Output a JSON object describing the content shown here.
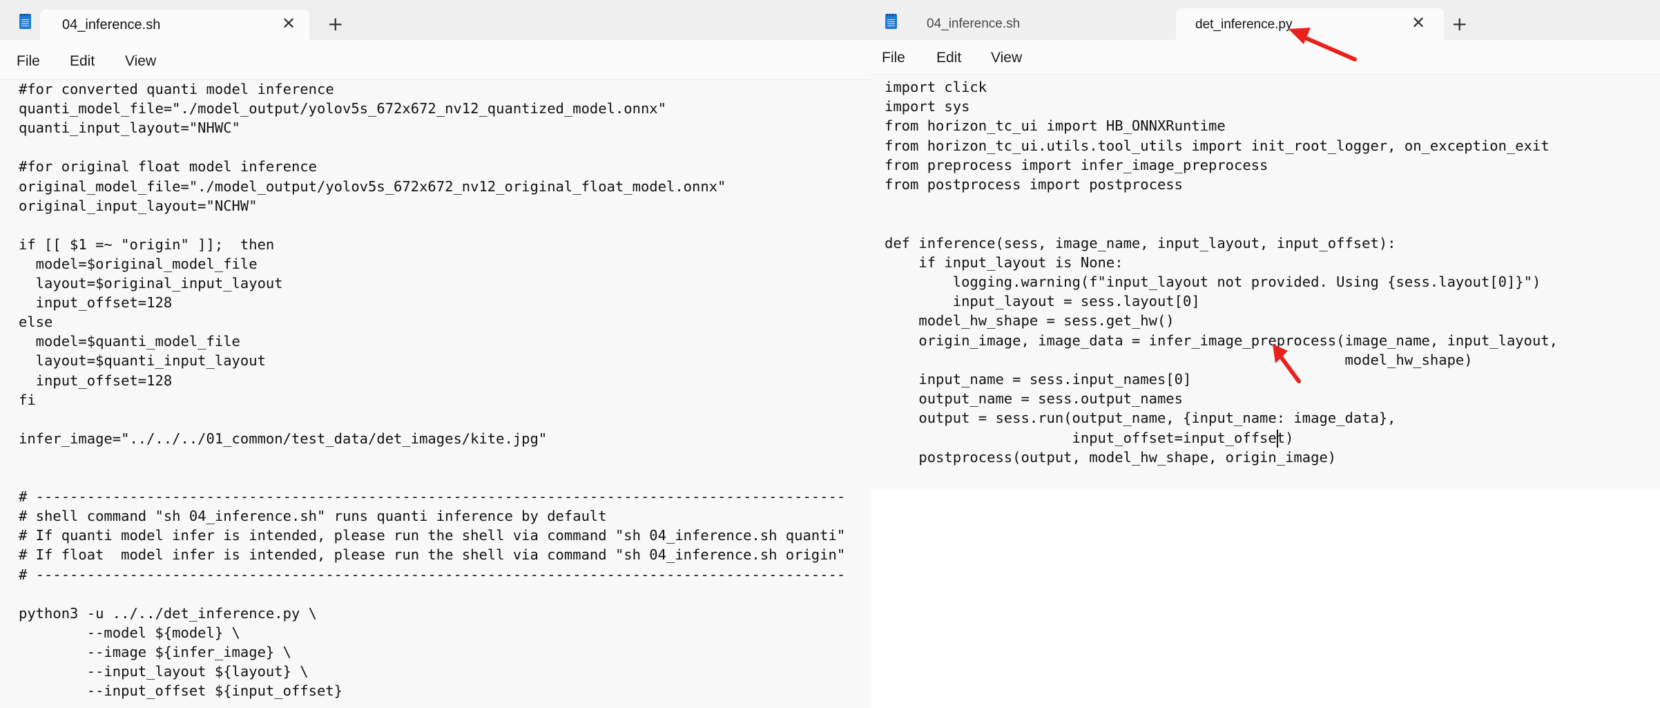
{
  "left_window": {
    "tab": {
      "label": "04_inference.sh",
      "close_symbol": "✕"
    },
    "new_tab_symbol": "+",
    "menu": [
      "File",
      "Edit",
      "View"
    ],
    "code_lines": [
      "#for converted quanti model inference",
      "quanti_model_file=\"./model_output/yolov5s_672x672_nv12_quantized_model.onnx\"",
      "quanti_input_layout=\"NHWC\"",
      "",
      "#for original float model inference",
      "original_model_file=\"./model_output/yolov5s_672x672_nv12_original_float_model.onnx\"",
      "original_input_layout=\"NCHW\"",
      "",
      "if [[ $1 =~ \"origin\" ]];  then",
      "  model=$original_model_file",
      "  layout=$original_input_layout",
      "  input_offset=128",
      "else",
      "  model=$quanti_model_file",
      "  layout=$quanti_input_layout",
      "  input_offset=128",
      "fi",
      "",
      "infer_image=\"../../../01_common/test_data/det_images/kite.jpg\"",
      "",
      "",
      "# -----------------------------------------------------------------------------------------------",
      "# shell command \"sh 04_inference.sh\" runs quanti inference by default",
      "# If quanti model infer is intended, please run the shell via command \"sh 04_inference.sh quanti\"",
      "# If float  model infer is intended, please run the shell via command \"sh 04_inference.sh origin\"",
      "# -----------------------------------------------------------------------------------------------",
      "",
      "python3 -u ../../det_inference.py \\",
      "        --model ${model} \\",
      "        --image ${infer_image} \\",
      "        --input_layout ${layout} \\",
      "        --input_offset ${input_offset}"
    ]
  },
  "right_window": {
    "tabs": [
      {
        "label": "04_inference.sh",
        "active": false
      },
      {
        "label": "det_inference.py",
        "active": true,
        "close_symbol": "✕"
      }
    ],
    "new_tab_symbol": "+",
    "menu": [
      "File",
      "Edit",
      "View"
    ],
    "code_lines": [
      "import click",
      "import sys",
      "from horizon_tc_ui import HB_ONNXRuntime",
      "from horizon_tc_ui.utils.tool_utils import init_root_logger, on_exception_exit",
      "from preprocess import infer_image_preprocess",
      "from postprocess import postprocess",
      "",
      "",
      "def inference(sess, image_name, input_layout, input_offset):",
      "    if input_layout is None:",
      "        logging.warning(f\"input_layout not provided. Using {sess.layout[0]}\")",
      "        input_layout = sess.layout[0]",
      "    model_hw_shape = sess.get_hw()",
      "    origin_image, image_data = infer_image_preprocess(image_name, input_layout,",
      "                                                      model_hw_shape)",
      "    input_name = sess.input_names[0]",
      "    output_name = sess.output_names",
      "    output = sess.run(output_name, {input_name: image_data},",
      "                      input_offset=input_offset)",
      "    postprocess(output, model_hw_shape, origin_image)"
    ]
  },
  "colors": {
    "titlebar": "#efefef",
    "editor_bg": "#f8f8f8",
    "annotation_arrow": "#e8211c",
    "app_icon": "#1e7ad4"
  },
  "icons": {
    "app": "notepad-icon",
    "close": "close-icon",
    "new_tab": "plus-icon",
    "annotation": "red-arrow-annotation"
  }
}
